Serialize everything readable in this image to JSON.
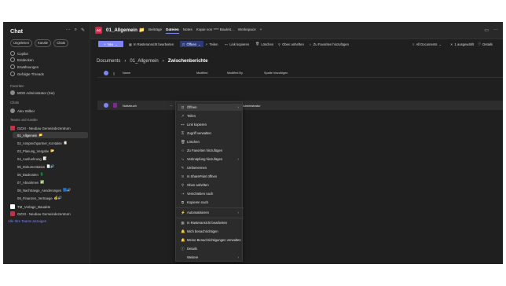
{
  "sidebar": {
    "title": "Chat",
    "filters": [
      "Ungelesen",
      "Kanäle",
      "Chats"
    ],
    "top_items": [
      "Copilot",
      "Entdecken",
      "Erwähnungen",
      "Gefolgte Threads"
    ],
    "favorites_label": "Favoriten",
    "favorites": [
      "MOD Administrator (Sie)"
    ],
    "chats_label": "Chats",
    "chats": [
      "Alex Wilber"
    ],
    "teams_label": "Teams und Kanäle",
    "teams": [
      {
        "name": "GZ24 - Neubau Gemeindezentrum",
        "color": "#c4314b",
        "channels": [
          {
            "label": "01_Allgemein",
            "emoji": "📁"
          },
          {
            "label": "02_Ansprechpartner_Kontakte",
            "emoji": "📋"
          },
          {
            "label": "03_Planung_Vergabe",
            "emoji": "📂"
          },
          {
            "label": "04_Ausfuehrung",
            "emoji": "📝"
          },
          {
            "label": "05_Dokumentation",
            "emoji": "📄🔊"
          },
          {
            "label": "06_Baukosten",
            "emoji": "💲"
          },
          {
            "label": "07_Abnahmen",
            "emoji": "✅"
          },
          {
            "label": "08_Nachtraege_Aenderungen",
            "emoji": "🟦🔊"
          },
          {
            "label": "09_Finanzen_Vertraege",
            "emoji": "💰🔊"
          }
        ]
      },
      {
        "name": "TM_Vorlage_Bauakte",
        "color": "#ffffff"
      },
      {
        "name": "GZ23 - Neubau Gemeindezentrum",
        "color": "#c4314b"
      }
    ],
    "all_teams_link": "Alle Ihre Teams anzeigen"
  },
  "header": {
    "badge": "GZ",
    "channel_title": "01_Allgemein 📁",
    "tabs": [
      "Beiträge",
      "Dateien",
      "Notes",
      "Kopie von **** Bauleit...",
      "Workspace",
      "+"
    ]
  },
  "toolbar": {
    "new_label": "Neu",
    "grid_edit": "In Rasteransicht bearbeiten",
    "open": "Öffnen",
    "share": "Teilen",
    "copy_link": "Link kopieren",
    "delete": "Löschen",
    "pin": "Oben anheften",
    "add_fav": "Zu Favoriten hinzufügen",
    "all_docs": "All Documents",
    "selected": "1 ausgewählt",
    "details": "Details"
  },
  "breadcrumb": {
    "root": "Documents",
    "mid": "01_Allgemein",
    "current": "Zwischenberichte"
  },
  "columns": {
    "name": "Name",
    "modified": "Modified",
    "modified_by": "Modified By",
    "add_column": "Spalte hinzufügen"
  },
  "files": [
    {
      "name": "Notizbuch",
      "modified_by": "Administrator"
    }
  ],
  "context_menu": {
    "items": [
      {
        "label": "Öffnen",
        "icon": "open-icon",
        "submenu": true
      },
      {
        "label": "Teilen",
        "icon": "share-icon"
      },
      {
        "label": "Link kopieren",
        "icon": "link-icon"
      },
      {
        "label": "Zugriff verwalten",
        "icon": "key-icon"
      },
      {
        "label": "Löschen",
        "icon": "trash-icon"
      },
      {
        "label": "Zu Favoriten hinzufügen",
        "icon": "star-icon"
      },
      {
        "label": "Verknüpfung hinzufügen",
        "icon": "shortcut-icon",
        "submenu": true
      },
      {
        "label": "Umbenennen",
        "icon": "rename-icon"
      },
      {
        "label": "In SharePoint öffnen",
        "icon": "sharepoint-icon"
      },
      {
        "label": "Oben anheften",
        "icon": "pin-icon"
      },
      {
        "label": "Verschieben nach",
        "icon": "move-icon"
      },
      {
        "label": "Kopieren nach",
        "icon": "copy-icon"
      },
      {
        "label": "Automatisieren",
        "icon": "automate-icon",
        "submenu": true
      },
      {
        "label": "In Rasteransicht bearbeiten",
        "icon": "grid-icon"
      },
      {
        "label": "Mich benachrichtigen",
        "icon": "bell-icon"
      },
      {
        "label": "Meine Benachrichtigungen verwalten",
        "icon": "bell-settings-icon"
      },
      {
        "label": "Details",
        "icon": "info-icon"
      },
      {
        "label": "Weitere",
        "icon": "more-icon",
        "submenu": true
      }
    ]
  },
  "colors": {
    "accent": "#7f85f5",
    "team_red": "#c4314b",
    "background": "#1f1f1f"
  }
}
